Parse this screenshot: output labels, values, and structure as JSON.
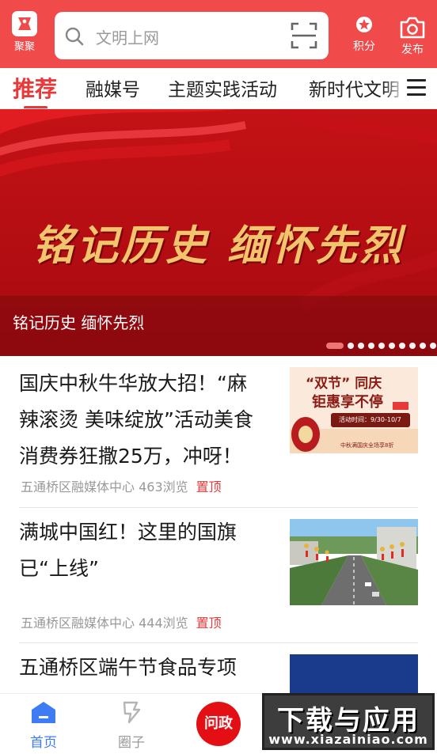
{
  "header": {
    "logo_label": "聚聚",
    "search_placeholder": "文明上网",
    "points_label": "积分",
    "publish_label": "发布"
  },
  "tabs": [
    {
      "label": "推荐",
      "active": true
    },
    {
      "label": "融媒号"
    },
    {
      "label": "主题实践活动"
    },
    {
      "label": "新时代文明"
    }
  ],
  "banner": {
    "title": "铭记历史  缅怀先烈",
    "caption": "铭记历史 缅怀先烈",
    "slide_count": 10,
    "active_slide": 1
  },
  "news": [
    {
      "title_lines": [
        "国庆中秋牛华放大招！“麻",
        "辣滚烫 美味绽放”活动美食",
        "消费券狂撒25万，冲呀！"
      ],
      "meta": "五通桥区融媒体中心 463浏览",
      "tag": "置顶",
      "thumb": {
        "heading": "“双节” 同庆",
        "subheading": "钜惠享不停",
        "time": "活动时间：9/30-10/7",
        "footer": "中秋满国庆全场享8折"
      }
    },
    {
      "title_lines": [
        "满城中国红！这里的国旗",
        "已“上线”"
      ],
      "meta": "五通桥区融媒体中心 444浏览",
      "tag": "置顶"
    },
    {
      "title_lines": [
        "五通桥区端午节食品专项"
      ]
    }
  ],
  "bottom_nav": {
    "home": "首页",
    "circle": "圈子",
    "wenzheng": "问政"
  },
  "watermark": {
    "big": "下载与应用",
    "small": "www.xiazainiao.com"
  },
  "colors": {
    "brand_red": "#f04a4a",
    "accent_red": "#e8393a",
    "home_blue": "#3d7cf4"
  }
}
